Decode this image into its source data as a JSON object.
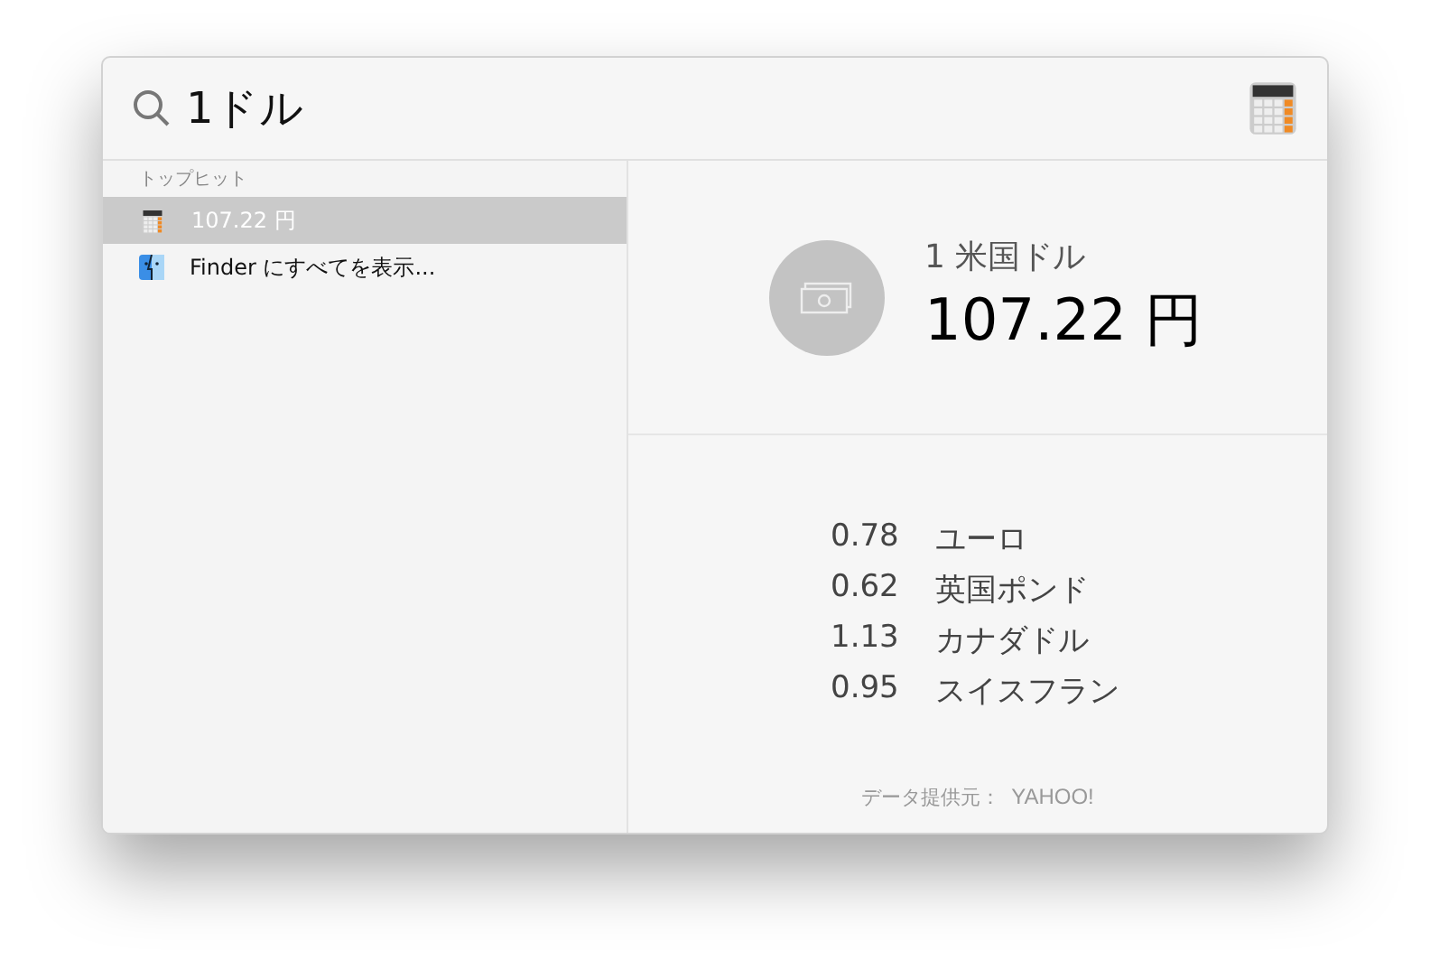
{
  "search": {
    "value": "1ドル"
  },
  "sidebar": {
    "section_title": "トップヒット",
    "items": [
      {
        "kind": "calculator",
        "label": "107.22 円",
        "selected": true
      },
      {
        "kind": "finder",
        "label": "Finder にすべてを表示...",
        "selected": false
      }
    ]
  },
  "result": {
    "subtitle": "1 米国ドル",
    "title": "107.22 円"
  },
  "rates": [
    {
      "value": "0.78",
      "currency": "ユーロ"
    },
    {
      "value": "0.62",
      "currency": "英国ポンド"
    },
    {
      "value": "1.13",
      "currency": "カナダドル"
    },
    {
      "value": "0.95",
      "currency": "スイスフラン"
    }
  ],
  "footer": {
    "label": "データ提供元：",
    "source": "YAHOO!"
  }
}
